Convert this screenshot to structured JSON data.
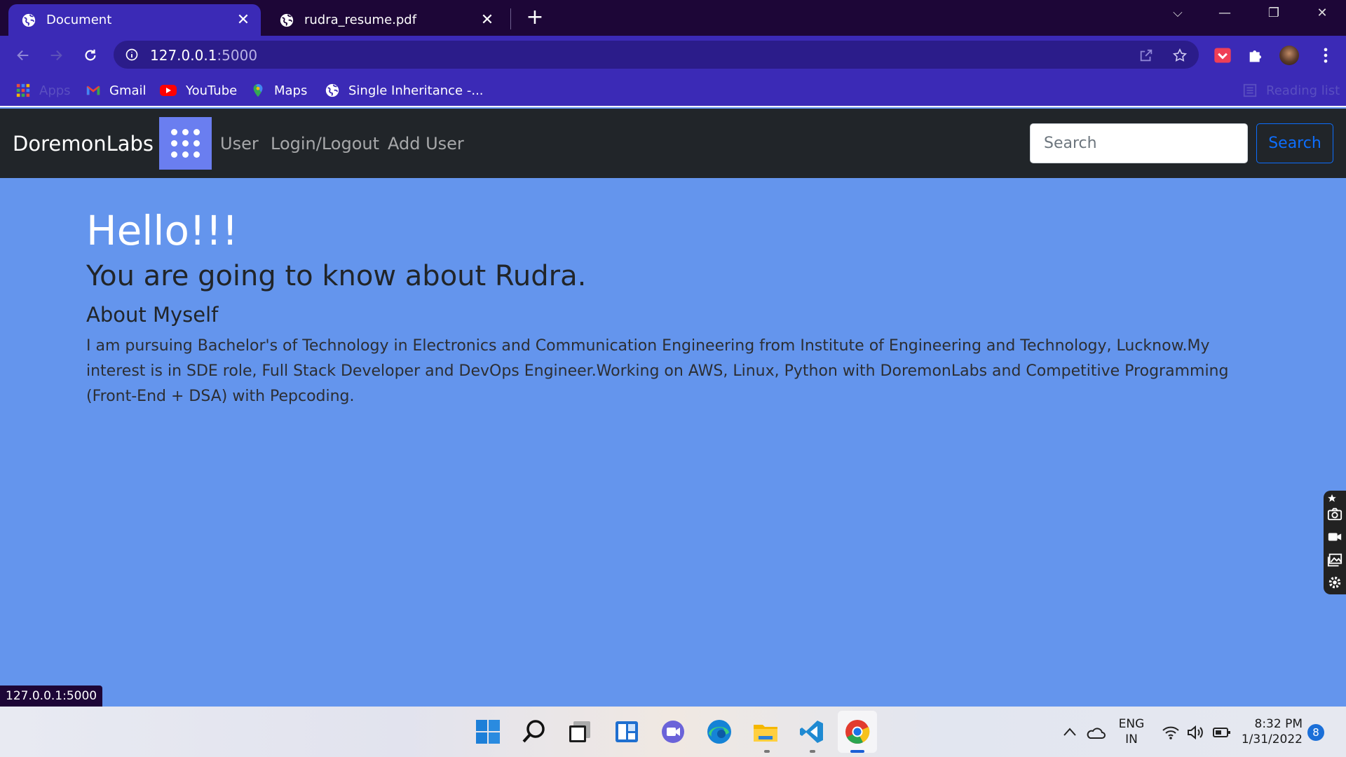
{
  "browser": {
    "tabs": [
      {
        "title": "Document",
        "active": true
      },
      {
        "title": "rudra_resume.pdf",
        "active": false
      }
    ],
    "new_tab_label": "+",
    "close_glyph": "✕",
    "window_controls": {
      "chevron": "⌵",
      "minimize": "—",
      "restore": "❐",
      "close": "✕"
    },
    "address": {
      "host": "127.0.0.1",
      "port": ":5000"
    },
    "bookmarks": [
      {
        "label": "Apps",
        "icon": "apps-grid-icon"
      },
      {
        "label": "Gmail",
        "icon": "gmail-icon"
      },
      {
        "label": "YouTube",
        "icon": "youtube-icon"
      },
      {
        "label": "Maps",
        "icon": "maps-icon"
      },
      {
        "label": "Single Inheritance -...",
        "icon": "globe-icon"
      }
    ],
    "reading_list": "Reading list",
    "status_url": "127.0.0.1:5000"
  },
  "site": {
    "brand": "DoremonLabs",
    "nav_links": [
      "User",
      "Login/Logout",
      "Add User"
    ],
    "search": {
      "placeholder": "Search",
      "button": "Search"
    },
    "heading": "Hello!!!",
    "subheading": "You are going to know about Rudra.",
    "section_title": "About Myself",
    "about_text": "I am pursuing Bachelor's of Technology in Electronics and Communication Engineering from Institute of Engineering and Technology, Lucknow.My interest is in SDE role, Full Stack Developer and DevOps Engineer.Working on AWS, Linux, Python with DoremonLabs and Competitive Programming (Front-End + DSA) with Pepcoding.",
    "colors": {
      "page_bg": "#6495ed",
      "navbar_bg": "#212529",
      "accent": "#0d6efd",
      "apps_tile": "#6a7ef0"
    }
  },
  "taskbar": {
    "apps": [
      "windows-start-icon",
      "search-icon",
      "task-view-icon",
      "widgets-icon",
      "teams-chat-icon",
      "edge-icon",
      "file-explorer-icon",
      "vscode-icon",
      "chrome-icon"
    ],
    "language": {
      "line1": "ENG",
      "line2": "IN"
    },
    "time": "8:32 PM",
    "date": "1/31/2022",
    "notification_count": "8"
  }
}
